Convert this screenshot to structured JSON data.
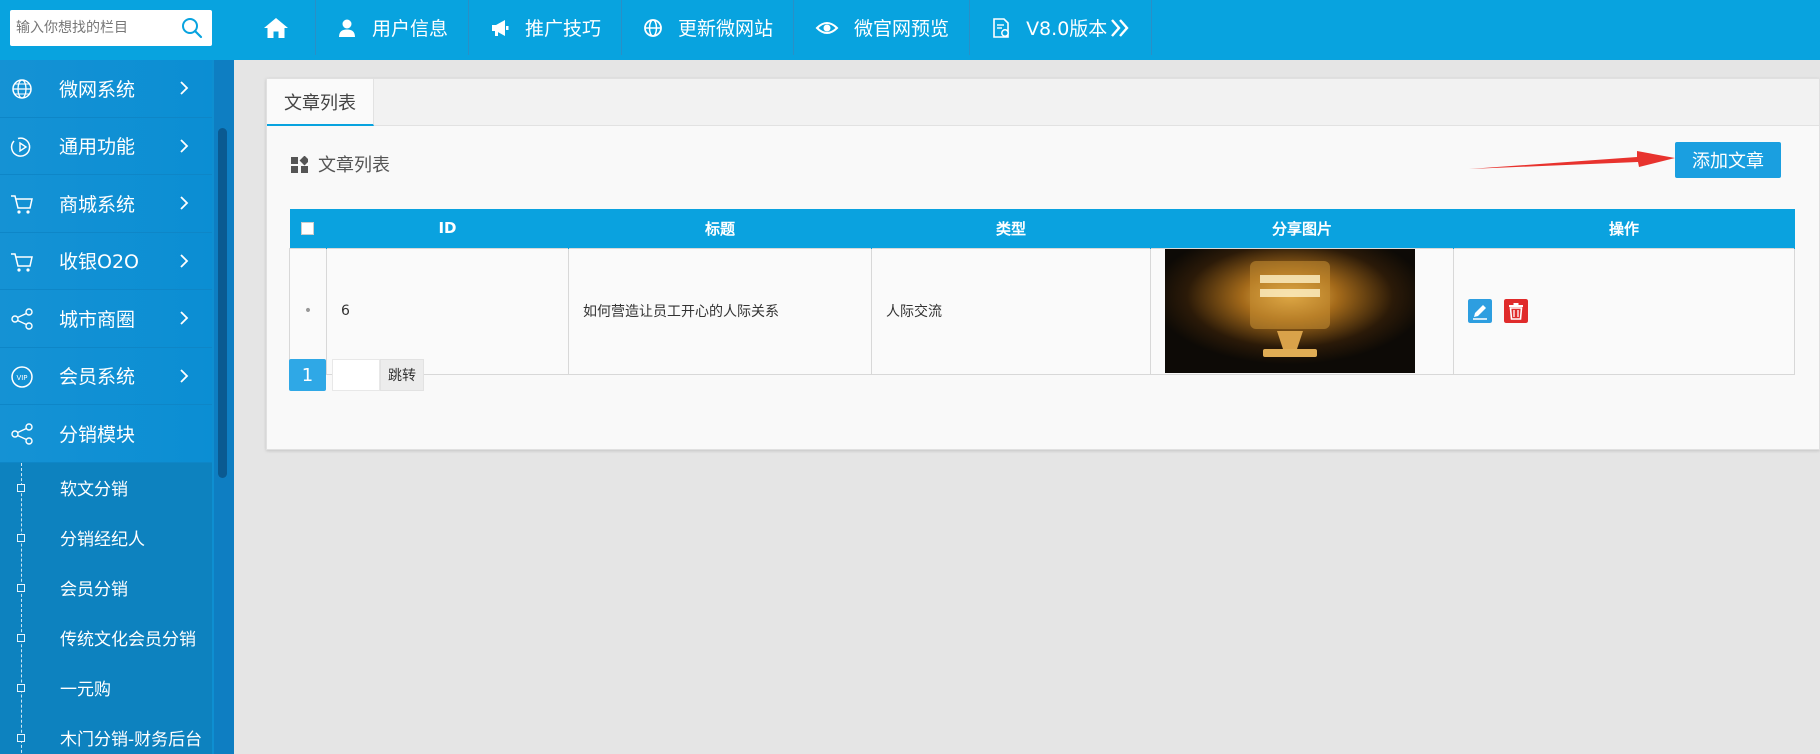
{
  "search": {
    "placeholder": "输入你想找的栏目"
  },
  "nav": {
    "items": [
      {
        "label": "用户信息",
        "icon": "user-icon"
      },
      {
        "label": "推广技巧",
        "icon": "megaphone-icon"
      },
      {
        "label": "更新微网站",
        "icon": "globe-icon"
      },
      {
        "label": "微官网预览",
        "icon": "eye-icon"
      },
      {
        "label": "V8.0版本",
        "icon": "settings-doc-icon"
      }
    ],
    "more_icon": "double-chevron-right-icon"
  },
  "sidebar": {
    "items": [
      {
        "label": "微网系统",
        "icon": "globe-icon"
      },
      {
        "label": "通用功能",
        "icon": "play-icon"
      },
      {
        "label": "商城系统",
        "icon": "cart-icon"
      },
      {
        "label": "收银O2O",
        "icon": "cart-icon"
      },
      {
        "label": "城市商圈",
        "icon": "share-icon"
      },
      {
        "label": "会员系统",
        "icon": "vip-icon"
      },
      {
        "label": "分销模块",
        "icon": "share-icon"
      }
    ],
    "subitems": [
      "软文分销",
      "分销经纪人",
      "会员分销",
      "传统文化会员分销",
      "一元购",
      "木门分销-财务后台"
    ]
  },
  "main": {
    "tab_label": "文章列表",
    "section_title": "文章列表",
    "add_button": "添加文章",
    "table": {
      "headers": [
        "ID",
        "标题",
        "类型",
        "分享图片",
        "操作"
      ],
      "rows": [
        {
          "bullet": "•",
          "id": "6",
          "title": "如何营造让员工开心的人际关系",
          "type": "人际交流",
          "image": "lamp-poster-thumbnail"
        }
      ]
    },
    "pagination": {
      "current_page": "1",
      "jump_label": "跳转"
    }
  },
  "colors": {
    "primary": "#08a3df",
    "sidebar": "#0e8fd1",
    "delete": "#e02b2b",
    "arrow": "#e8332e"
  }
}
